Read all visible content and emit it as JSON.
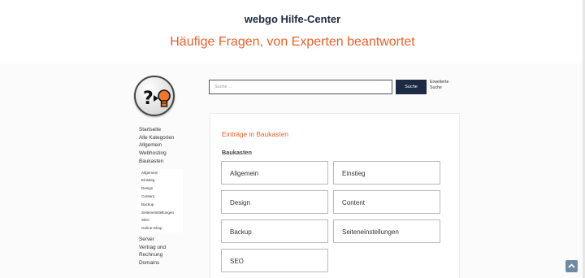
{
  "header": {
    "site_title": "webgo Hilfe-Center",
    "tagline": "Häufige Fragen, von Experten beantwortet"
  },
  "logo": {
    "icon": "question-lightbulb-icon"
  },
  "search": {
    "placeholder": "Suche ...",
    "button_label": "Suche",
    "advanced_line1": "Erweiterte",
    "advanced_line2": "Suche"
  },
  "sidebar": {
    "items": [
      {
        "label": "Startseite"
      },
      {
        "label": "Alle Kategorien"
      },
      {
        "label": "Allgemein"
      },
      {
        "label": "Webhosting"
      },
      {
        "label": "Baukasten"
      }
    ],
    "subitems": [
      {
        "label": "Allgemein"
      },
      {
        "label": "Einstieg"
      },
      {
        "label": "Design"
      },
      {
        "label": "Content"
      },
      {
        "label": "Backup"
      },
      {
        "label": "Seiteneinstellungen"
      },
      {
        "label": "SEO"
      },
      {
        "label": "Online-Shop"
      }
    ],
    "items_after": [
      {
        "label": "Server"
      },
      {
        "label": "Vertrag und"
      },
      {
        "label": "Rechnung"
      },
      {
        "label": "Domains"
      }
    ]
  },
  "main": {
    "heading": "Einträge in Baukasten",
    "section_title": "Baukasten",
    "categories": [
      {
        "label": "Allgemein"
      },
      {
        "label": "Einstieg"
      },
      {
        "label": "Design"
      },
      {
        "label": "Content"
      },
      {
        "label": "Backup"
      },
      {
        "label": "Seiteneinstellungen"
      },
      {
        "label": "SEO"
      }
    ]
  },
  "colors": {
    "accent": "#e8612c",
    "navy": "#1d2a44",
    "scroll_button": "#6f8aa3"
  },
  "scroll_top_icon": "chevron-up-icon"
}
